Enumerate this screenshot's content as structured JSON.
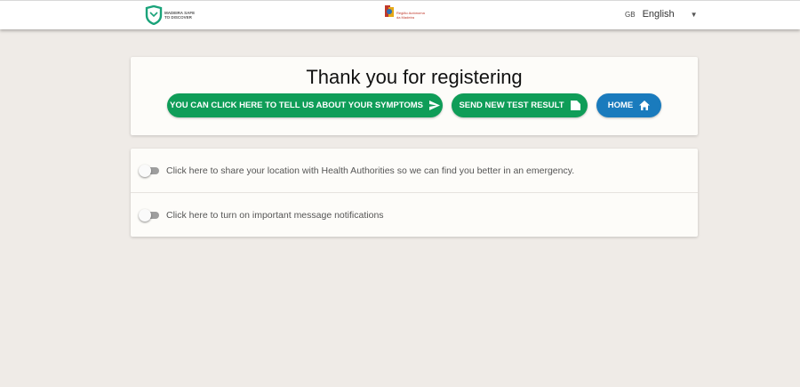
{
  "header": {
    "left_logo_text": "MADEIRA SAFE TO DISCOVER",
    "center_logo_text": "Região Autónoma da Madeira",
    "language": {
      "flag": "GB",
      "label": "English"
    }
  },
  "main": {
    "title": "Thank you for registering",
    "buttons": {
      "symptoms": "YOU CAN CLICK HERE TO TELL US ABOUT YOUR SYMPTOMS",
      "test": "SEND NEW TEST RESULT",
      "home": "HOME"
    }
  },
  "settings": {
    "location": {
      "label": "Click here to share your location with Health Authorities so we can find you better in an emergency.",
      "enabled": false
    },
    "notifications": {
      "label": "Click here to turn on important message notifications",
      "enabled": false
    }
  },
  "colors": {
    "green": "#0f9d58",
    "blue": "#1a7bbd",
    "background": "#efebe7"
  },
  "icons": [
    "send-icon",
    "file-icon",
    "home-icon",
    "chevron-down-icon",
    "shield-logo-icon",
    "government-crest-icon"
  ]
}
